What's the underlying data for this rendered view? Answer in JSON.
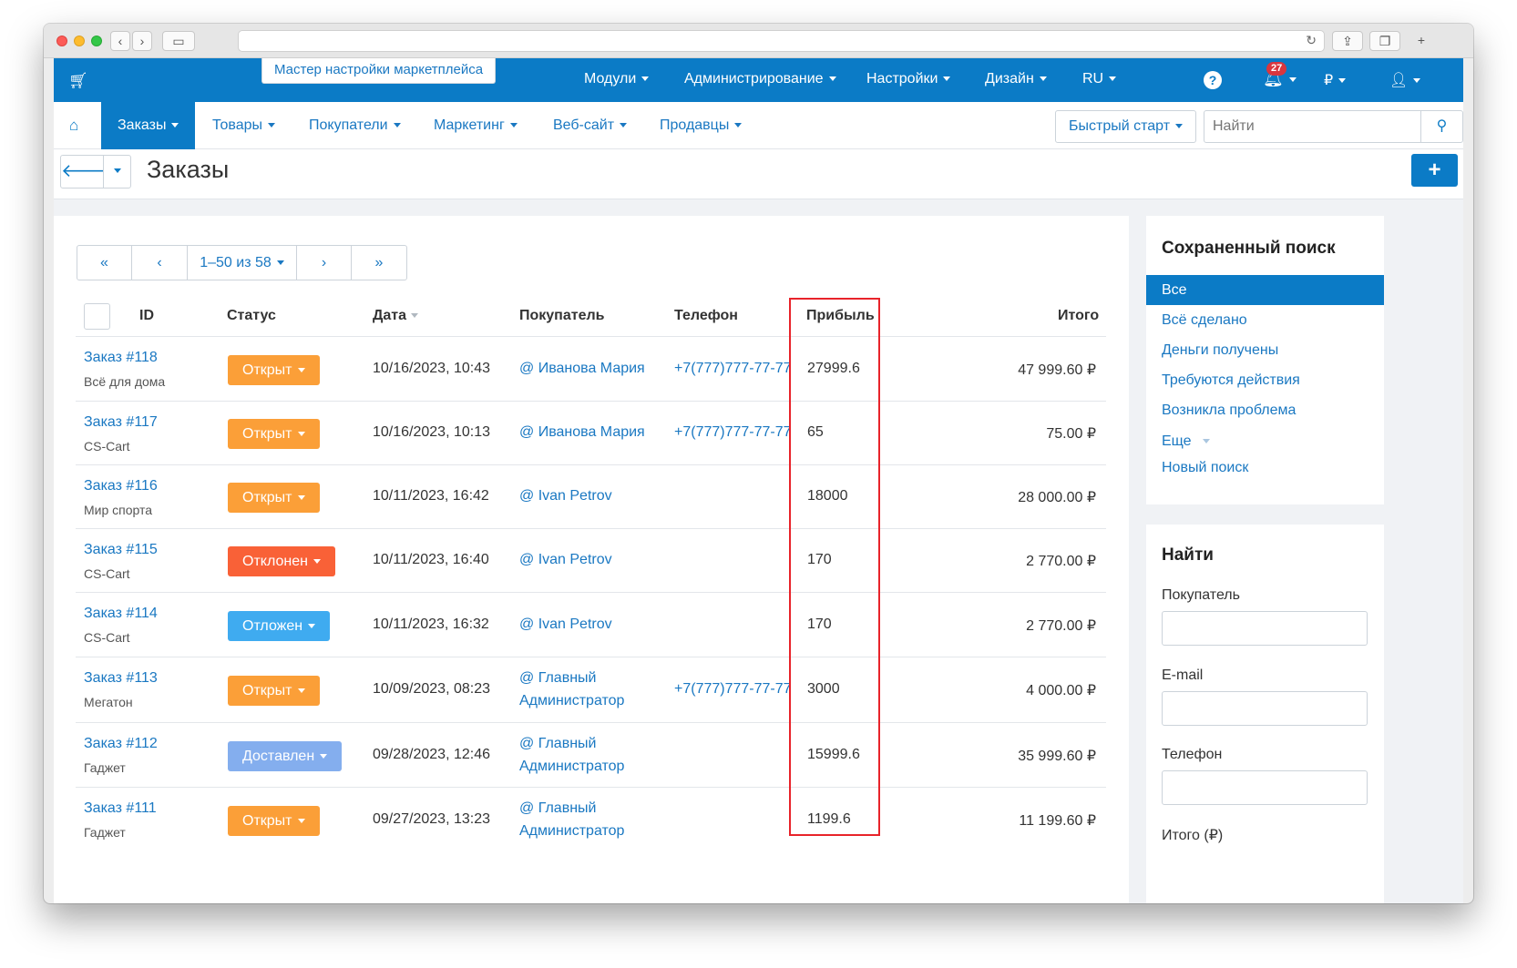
{
  "colors": {
    "brand": "#0b7bc6",
    "link": "#1a78c2",
    "open": "#fb9f38",
    "declined": "#f96137",
    "postponed": "#3fabf0",
    "delivered": "#84aeee",
    "highlight": "#e8232a"
  },
  "topbar": {
    "master_setup": "Мастер настройки маркетплейса",
    "menu": [
      "Модули",
      "Администрирование",
      "Настройки",
      "Дизайн",
      "RU"
    ],
    "notifications_count": "27",
    "currency": "₽"
  },
  "navbar": {
    "items": [
      "Заказы",
      "Товары",
      "Покупатели",
      "Маркетинг",
      "Веб-сайт",
      "Продавцы"
    ],
    "active": "Заказы",
    "quick_start": "Быстрый старт",
    "search_placeholder": "Найти"
  },
  "page": {
    "title": "Заказы"
  },
  "pager": {
    "range": "1–50 из 58"
  },
  "table": {
    "headers": {
      "id": "ID",
      "status": "Статус",
      "date": "Дата",
      "customer": "Покупатель",
      "phone": "Телефон",
      "profit": "Прибыль",
      "total": "Итого"
    },
    "rows": [
      {
        "order": "Заказ #118",
        "store": "Всё для дома",
        "status": "Открыт",
        "status_type": "open",
        "date": "10/16/2023, 10:43",
        "customer1": "@ Иванова Мария",
        "customer2": "",
        "phone": "+7(777)777-77-77",
        "profit": "27999.6",
        "total": "47 999.60 ₽"
      },
      {
        "order": "Заказ #117",
        "store": "CS-Cart",
        "status": "Открыт",
        "status_type": "open",
        "date": "10/16/2023, 10:13",
        "customer1": "@ Иванова Мария",
        "customer2": "",
        "phone": "+7(777)777-77-77",
        "profit": "65",
        "total": "75.00 ₽"
      },
      {
        "order": "Заказ #116",
        "store": "Мир спорта",
        "status": "Открыт",
        "status_type": "open",
        "date": "10/11/2023, 16:42",
        "customer1": "@ Ivan Petrov",
        "customer2": "",
        "phone": "",
        "profit": "18000",
        "total": "28 000.00 ₽"
      },
      {
        "order": "Заказ #115",
        "store": "CS-Cart",
        "status": "Отклонен",
        "status_type": "declined",
        "date": "10/11/2023, 16:40",
        "customer1": "@ Ivan Petrov",
        "customer2": "",
        "phone": "",
        "profit": "170",
        "total": "2 770.00 ₽"
      },
      {
        "order": "Заказ #114",
        "store": "CS-Cart",
        "status": "Отложен",
        "status_type": "postponed",
        "date": "10/11/2023, 16:32",
        "customer1": "@ Ivan Petrov",
        "customer2": "",
        "phone": "",
        "profit": "170",
        "total": "2 770.00 ₽"
      },
      {
        "order": "Заказ #113",
        "store": "Мегатон",
        "status": "Открыт",
        "status_type": "open",
        "date": "10/09/2023, 08:23",
        "customer1": "@ Главный",
        "customer2": "Администратор",
        "phone": "+7(777)777-77-77",
        "profit": "3000",
        "total": "4 000.00 ₽"
      },
      {
        "order": "Заказ #112",
        "store": "Гаджет",
        "status": "Доставлен",
        "status_type": "delivered",
        "date": "09/28/2023, 12:46",
        "customer1": "@ Главный",
        "customer2": "Администратор",
        "phone": "",
        "profit": "15999.6",
        "total": "35 999.60 ₽"
      },
      {
        "order": "Заказ #111",
        "store": "Гаджет",
        "status": "Открыт",
        "status_type": "open",
        "date": "09/27/2023, 13:23",
        "customer1": "@ Главный",
        "customer2": "Администратор",
        "phone": "",
        "profit": "1199.6",
        "total": "11 199.60 ₽"
      }
    ]
  },
  "saved_search": {
    "title": "Сохраненный поиск",
    "items": [
      "Все",
      "Всё сделано",
      "Деньги получены",
      "Требуются действия",
      "Возникла проблема",
      "Еще",
      "Новый поиск"
    ],
    "active": "Все"
  },
  "find": {
    "title": "Найти",
    "fields": [
      "Покупатель",
      "E-mail",
      "Телефон",
      "Итого (₽)"
    ]
  }
}
